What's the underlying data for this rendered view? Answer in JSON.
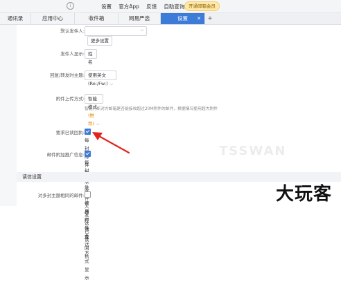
{
  "topbar": {
    "links": [
      "设置",
      "官方App",
      "反馈",
      "自助查询"
    ],
    "vip_label": "开通邮箱会员"
  },
  "tabs": [
    {
      "label": "通讯录",
      "active": false
    },
    {
      "label": "应用中心",
      "active": false
    },
    {
      "label": "收件箱",
      "active": false
    },
    {
      "label": "网易严选",
      "active": false
    },
    {
      "label": "设置",
      "active": true
    }
  ],
  "settings": {
    "default_sender_label": "默认发件人:",
    "more_settings_label": "更多设置",
    "sender_display_label": "发件人显示:",
    "sender_display_value": "姓名",
    "reply_subject_label": "回复/转发时主题:",
    "reply_subject_value": "使用英文 (Re:/Fw:)",
    "attachment_label": "附件上传方式:",
    "attachment_value": "智能模式",
    "attachment_tag": "(推荐)",
    "attachment_hint": "智能判断对方邮箱是否能接收超过20M附件的邮件，根据情况使用超大附件",
    "read_receipt_label": "要求已读回执:",
    "read_receipt_text": "每封邮件要求收件人发送已读回执",
    "read_receipt_checked": true,
    "promo_label": "邮件附加推广信息:",
    "promo_text": "每封邮件显示推广信息",
    "promo_checked": true
  },
  "reading_section": {
    "title": "读信设置",
    "same_subject_label": "对多封主题相同的邮件:",
    "same_subject_text": "使用邮件会话方式显示",
    "same_subject_checked": false
  },
  "watermark": "大玩客",
  "colors": {
    "accent": "#3d7bd9",
    "arrow": "#e3241b"
  }
}
